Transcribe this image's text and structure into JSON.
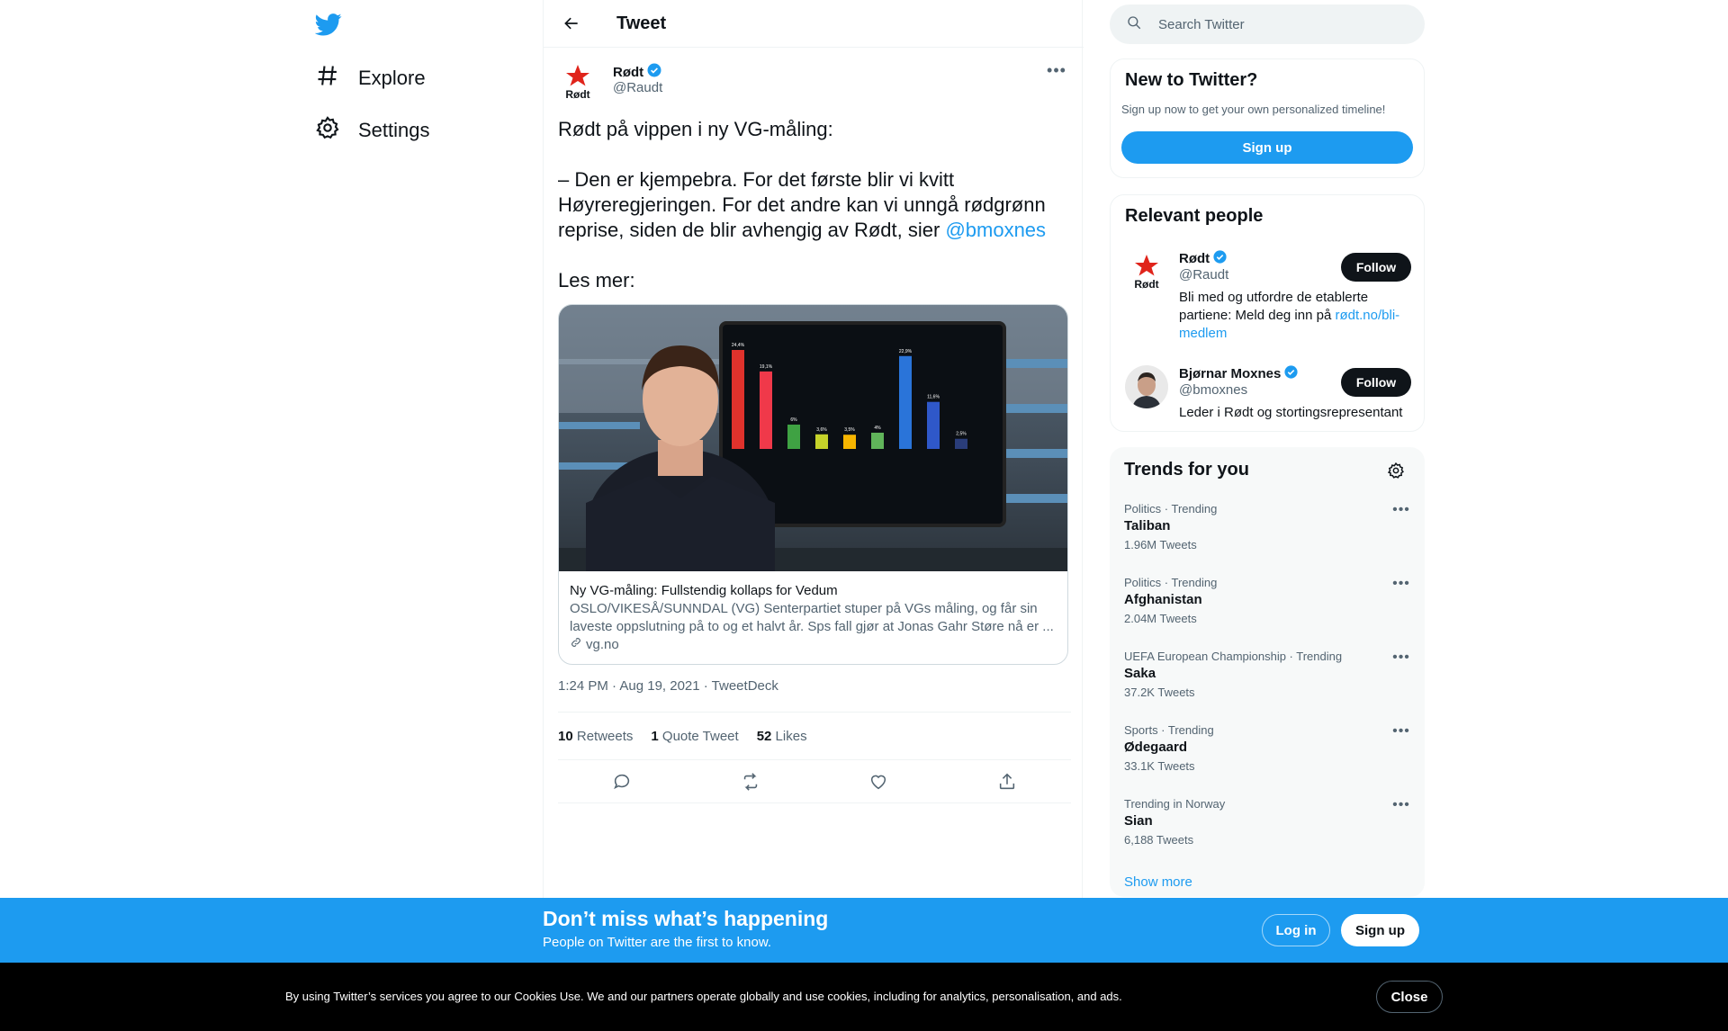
{
  "nav": {
    "items": [
      {
        "label": "Explore",
        "icon": "hashtag-icon"
      },
      {
        "label": "Settings",
        "icon": "gear-icon"
      }
    ]
  },
  "header": {
    "title": "Tweet"
  },
  "tweet": {
    "author_name": "Rødt",
    "author_handle": "@Raudt",
    "avatar_text": "Rødt",
    "text_line1": "Rødt på vippen i ny VG-måling:",
    "text_body": "– Den er kjempebra. For det første blir vi kvitt Høyreregjeringen. For det andre kan vi unngå rødgrønn reprise, siden de blir avhengig av Rødt, sier ",
    "mention": "@bmoxnes",
    "text_end": "Les mer:",
    "card": {
      "title": "Ny VG-måling: Fullstendig kollaps for Vedum",
      "description": "OSLO/VIKESÅ/SUNNDAL (VG) Senterpartiet stuper på VGs måling, og får sin laveste oppslutning på to og et halvt år. Sps fall gjør at Jonas Gahr Støre nå er ...",
      "domain": "vg.no",
      "image_bars": [
        {
          "label": "24,4%",
          "value": 24.4,
          "color": "#e0322c"
        },
        {
          "label": "19,1%",
          "value": 19.1,
          "color": "#f0394a"
        },
        {
          "label": "6%",
          "value": 6,
          "color": "#3fa243"
        },
        {
          "label": "3,6%",
          "value": 3.6,
          "color": "#c6d32a"
        },
        {
          "label": "3,5%",
          "value": 3.5,
          "color": "#f7b500"
        },
        {
          "label": "4%",
          "value": 4,
          "color": "#60b45a"
        },
        {
          "label": "22,9%",
          "value": 22.9,
          "color": "#2a74d9"
        },
        {
          "label": "11,6%",
          "value": 11.6,
          "color": "#2f58c9"
        },
        {
          "label": "2,5%",
          "value": 2.5,
          "color": "#2a3d7a"
        }
      ]
    },
    "timestamp": "1:24 PM · Aug 19, 2021 · TweetDeck",
    "stats": {
      "retweets": "10",
      "retweets_label": "Retweets",
      "quotes": "1",
      "quotes_label": "Quote Tweet",
      "likes": "52",
      "likes_label": "Likes"
    }
  },
  "search": {
    "placeholder": "Search Twitter"
  },
  "signup_panel": {
    "title": "New to Twitter?",
    "subtitle": "Sign up now to get your own personalized timeline!",
    "button": "Sign up"
  },
  "relevant": {
    "title": "Relevant people",
    "people": [
      {
        "name": "Rødt",
        "handle": "@Raudt",
        "bio": "Bli med og utfordre de etablerte partiene: Meld deg inn på ",
        "bio_link": "rødt.no/bli-medlem",
        "button": "Follow"
      },
      {
        "name": "Bjørnar Moxnes",
        "handle": "@bmoxnes",
        "bio": "Leder i Rødt og stortingsrepresentant",
        "bio_link": "",
        "button": "Follow"
      }
    ]
  },
  "trends": {
    "title": "Trends for you",
    "items": [
      {
        "meta": "Politics · Trending",
        "name": "Taliban",
        "count": "1.96M Tweets"
      },
      {
        "meta": "Politics · Trending",
        "name": "Afghanistan",
        "count": "2.04M Tweets"
      },
      {
        "meta": "UEFA European Championship · Trending",
        "name": "Saka",
        "count": "37.2K Tweets"
      },
      {
        "meta": "Sports · Trending",
        "name": "Ødegaard",
        "count": "33.1K Tweets"
      },
      {
        "meta": "Trending in Norway",
        "name": "Sian",
        "count": "6,188 Tweets"
      }
    ],
    "show_more": "Show more"
  },
  "banner": {
    "title": "Don’t miss what’s happening",
    "subtitle": "People on Twitter are the first to know.",
    "login": "Log in",
    "signup": "Sign up"
  },
  "cookie": {
    "text": "By using Twitter’s services you agree to our Cookies Use. We and our partners operate globally and use cookies, including for analytics, personalisation, and ads.",
    "close": "Close"
  },
  "colors": {
    "brand": "#1d9bf0",
    "text": "#0f1419",
    "muted": "#536471",
    "rodt_red": "#e0241b"
  }
}
